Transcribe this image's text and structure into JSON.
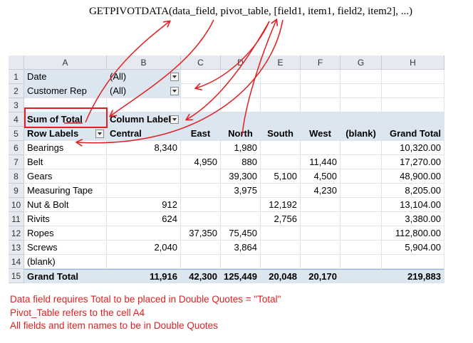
{
  "formula": "GETPIVOTDATA(data_field, pivot_table, [field1, item1, field2, item2], ...)",
  "columns": [
    "A",
    "B",
    "C",
    "D",
    "E",
    "F",
    "G",
    "H"
  ],
  "rows": [
    {
      "num": "1",
      "cells": [
        "Date",
        "(All)",
        "",
        "",
        "",
        "",
        "",
        ""
      ]
    },
    {
      "num": "2",
      "cells": [
        "Customer Rep",
        "(All)",
        "",
        "",
        "",
        "",
        "",
        ""
      ]
    },
    {
      "num": "3",
      "cells": [
        "",
        "",
        "",
        "",
        "",
        "",
        "",
        ""
      ]
    },
    {
      "num": "4",
      "cells": [
        "Sum of Total",
        "Column Labels",
        "",
        "",
        "",
        "",
        "",
        ""
      ]
    },
    {
      "num": "5",
      "cells": [
        "Row Labels",
        "Central",
        "East",
        "North",
        "South",
        "West",
        "(blank)",
        "Grand Total"
      ]
    },
    {
      "num": "6",
      "cells": [
        "Bearings",
        "8,340",
        "",
        "1,980",
        "",
        "",
        "",
        "10,320.00"
      ]
    },
    {
      "num": "7",
      "cells": [
        "Belt",
        "",
        "4,950",
        "880",
        "",
        "11,440",
        "",
        "17,270.00"
      ]
    },
    {
      "num": "8",
      "cells": [
        "Gears",
        "",
        "",
        "39,300",
        "5,100",
        "4,500",
        "",
        "48,900.00"
      ]
    },
    {
      "num": "9",
      "cells": [
        "Measuring Tape",
        "",
        "",
        "3,975",
        "",
        "4,230",
        "",
        "8,205.00"
      ]
    },
    {
      "num": "10",
      "cells": [
        "Nut & Bolt",
        "912",
        "",
        "",
        "12,192",
        "",
        "",
        "13,104.00"
      ]
    },
    {
      "num": "11",
      "cells": [
        "Rivits",
        "624",
        "",
        "",
        "2,756",
        "",
        "",
        "3,380.00"
      ]
    },
    {
      "num": "12",
      "cells": [
        "Ropes",
        "",
        "37,350",
        "75,450",
        "",
        "",
        "",
        "112,800.00"
      ]
    },
    {
      "num": "13",
      "cells": [
        "Screws",
        "2,040",
        "",
        "3,864",
        "",
        "",
        "",
        "5,904.00"
      ]
    },
    {
      "num": "14",
      "cells": [
        "(blank)",
        "",
        "",
        "",
        "",
        "",
        "",
        ""
      ]
    },
    {
      "num": "15",
      "cells": [
        "Grand Total",
        "11,916",
        "42,300",
        "125,449",
        "20,048",
        "20,170",
        "",
        "219,883"
      ]
    }
  ],
  "notes": [
    "Data field requires Total to be placed in Double Quotes = \"Total\"",
    "Pivot_Table refers to the cell A4",
    "All fields and item names to be in Double Quotes"
  ],
  "colors": {
    "annotation": "#e02020",
    "pivot_fill": "#dce6f1",
    "header_fill": "#e6e9ef"
  }
}
